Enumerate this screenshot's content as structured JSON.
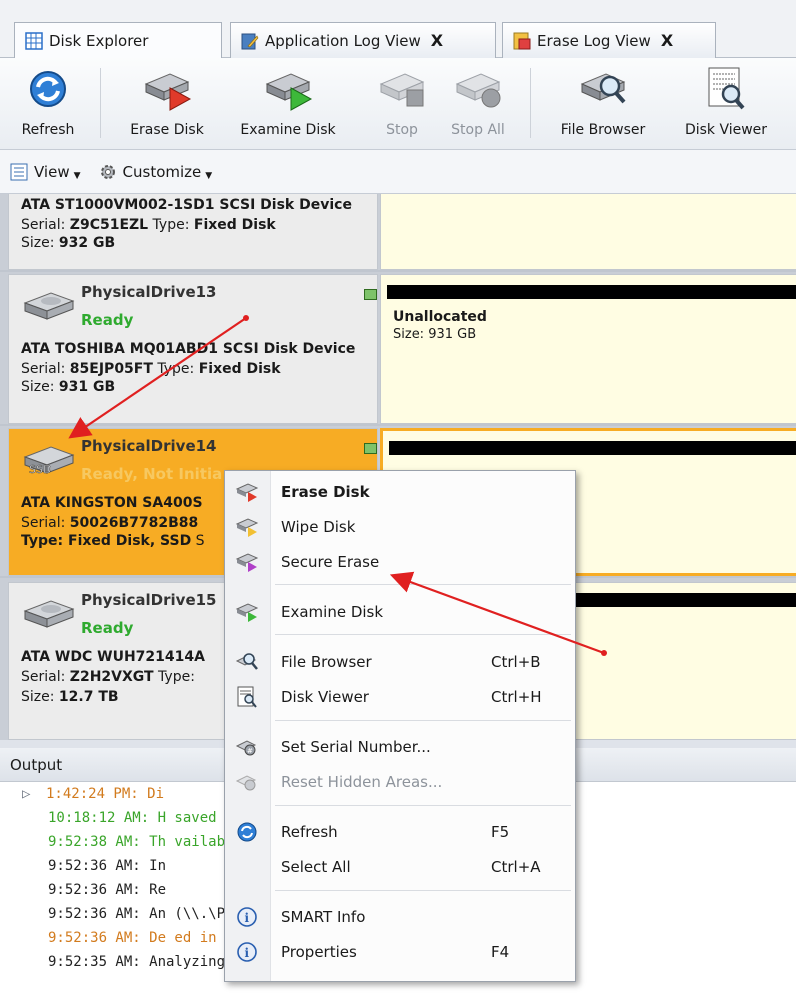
{
  "tabs": [
    {
      "label": "Disk Explorer",
      "close": ""
    },
    {
      "label": "Application Log View",
      "close": "X"
    },
    {
      "label": "Erase Log View",
      "close": "X"
    }
  ],
  "toolbar": {
    "refresh": "Refresh",
    "erase_disk": "Erase Disk",
    "examine_disk": "Examine Disk",
    "stop": "Stop",
    "stop_all": "Stop All",
    "file_browser": "File Browser",
    "disk_viewer": "Disk Viewer"
  },
  "viewbar": {
    "view": "View",
    "customize": "Customize"
  },
  "disks": [
    {
      "name": "",
      "status": "",
      "model": "ATA ST1000VM002-1SD1 SCSI Disk Device",
      "serial_label": "Serial:",
      "serial": "Z9C51EZL",
      "type_label": "Type:",
      "type": "Fixed Disk",
      "size_label": "Size:",
      "size": "932 GB",
      "partition_title": "",
      "partition_size": ""
    },
    {
      "name": "PhysicalDrive13",
      "status": "Ready",
      "model": "ATA TOSHIBA MQ01ABD1 SCSI Disk Device",
      "serial_label": "Serial:",
      "serial": "85EJP05FT",
      "type_label": "Type:",
      "type": "Fixed Disk",
      "size_label": "Size:",
      "size": "931 GB",
      "partition_title": "Unallocated",
      "partition_size": "Size: 931 GB"
    },
    {
      "name": "PhysicalDrive14",
      "status": "Ready, Not Initia",
      "model": "ATA KINGSTON SA400S",
      "serial_label": "Serial:",
      "serial": "50026B7782B88",
      "type_label": "Type:",
      "type": "Fixed Disk, SSD",
      "size_label": "S",
      "icon_label": "SSD"
    },
    {
      "name": "PhysicalDrive15",
      "status": "Ready",
      "model": "ATA WDC WUH721414A",
      "serial_label": "Serial:",
      "serial": "Z2H2VXGT",
      "type_label": "Type:",
      "type": "",
      "size_label": "Size:",
      "size": "12.7 TB"
    }
  ],
  "output": {
    "title": "Output",
    "lines": [
      {
        "text": "1:42:24 PM: Di",
        "color": "#d27b1e"
      },
      {
        "text": "10:18:12 AM: H                   saved at 'C:\\Progr",
        "color": "#3aa52a"
      },
      {
        "text": "9:52:38 AM: Th                   vailable for downl",
        "color": "#3aa52a"
      },
      {
        "text": "9:52:36 AM: In",
        "color": "#222222"
      },
      {
        "text": "9:52:36 AM: Re",
        "color": "#222222"
      },
      {
        "text": "9:52:36 AM: An                   (\\\\.\\PhysicalDriv",
        "color": "#222222"
      },
      {
        "text": "9:52:36 AM: De                  ed in bay Bay 2-8",
        "color": "#d27b1e"
      },
      {
        "text": "9:52:35 AM: Analyzing disk 'Fixed Disk 14 (\\\\.\\PhysicalDriv",
        "color": "#222222"
      }
    ]
  },
  "menu": {
    "erase_disk": "Erase Disk",
    "wipe_disk": "Wipe Disk",
    "secure_erase": "Secure Erase",
    "examine_disk": "Examine Disk",
    "file_browser": "File Browser",
    "file_browser_shortcut": "Ctrl+B",
    "disk_viewer": "Disk Viewer",
    "disk_viewer_shortcut": "Ctrl+H",
    "set_serial": "Set Serial Number...",
    "reset_hidden": "Reset Hidden Areas...",
    "refresh": "Refresh",
    "refresh_shortcut": "F5",
    "select_all": "Select All",
    "select_all_shortcut": "Ctrl+A",
    "smart_info": "SMART Info",
    "properties": "Properties",
    "properties_shortcut": "F4"
  },
  "colors": {
    "selected": "#f7ac24",
    "ready": "#2faa2f",
    "annotation": "#e02020",
    "partition_bg": "#fffde3"
  }
}
